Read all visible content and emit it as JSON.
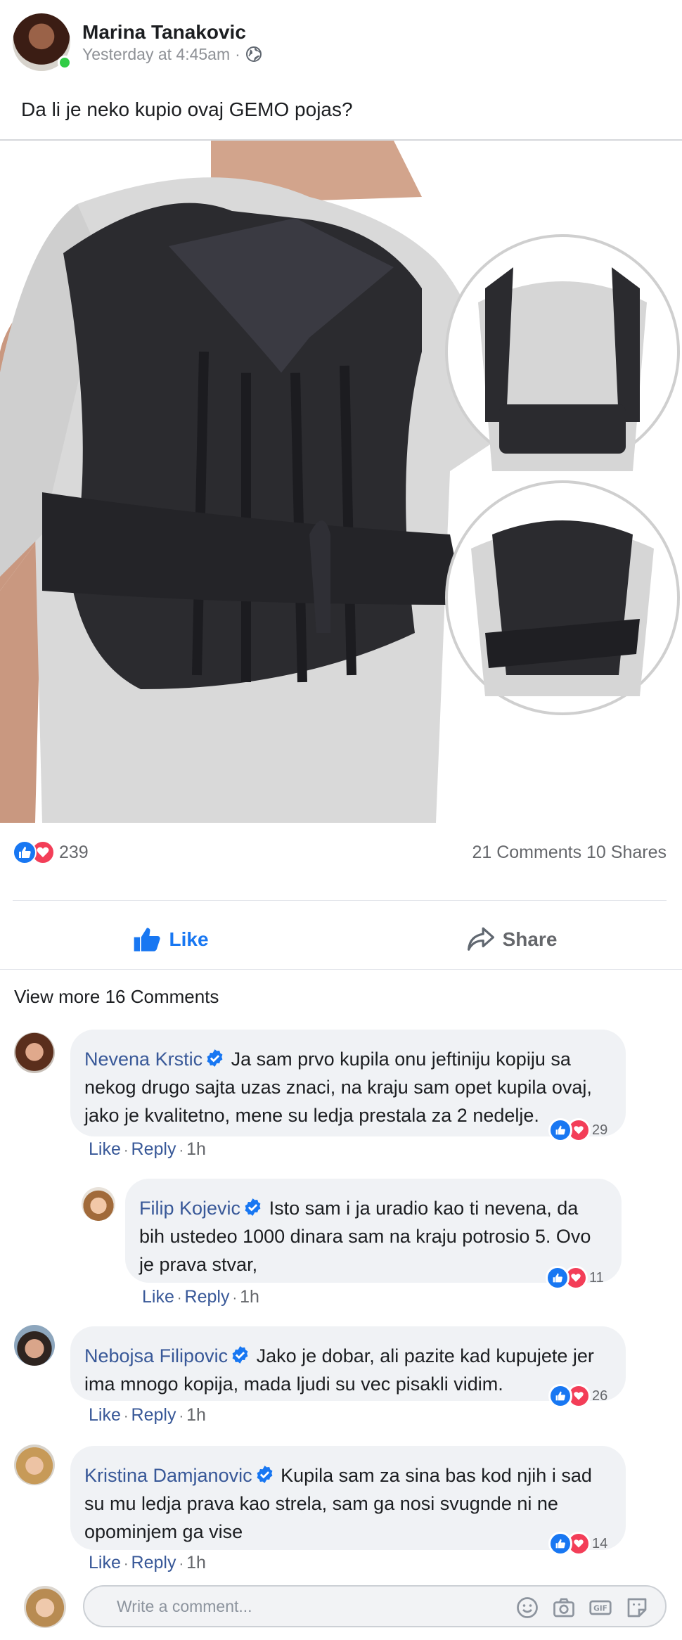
{
  "post": {
    "author": "Marina Tanakovic",
    "timestamp": "Yesterday at 4:45am",
    "meta_separator": "·",
    "privacy_icon": "globe-icon",
    "text": "Da li je neko kupio ovaj GEMO pojas?"
  },
  "stats": {
    "reaction_count": "239",
    "comments_shares": "21 Comments 10 Shares"
  },
  "actions": {
    "like_label": "Like",
    "share_label": "Share"
  },
  "view_more": "View more 16 Comments",
  "comments": [
    {
      "name": "Nevena Krstic",
      "text": "Ja sam prvo kupila onu jeftiniju kopiju sa nekog drugo sajta uzas znaci, na kraju sam opet kupila ovaj, jako je kvalitetno, mene su ledja prestala za 2 nedelje.",
      "reaction_count": "29",
      "like": "Like",
      "reply": "Reply",
      "time": "1h"
    },
    {
      "name": "Filip Kojevic",
      "text": "Isto sam i ja uradio kao ti nevena, da bih ustedeo 1000 dinara sam na kraju potrosio 5. Ovo je prava stvar,",
      "reaction_count": "11",
      "like": "Like",
      "reply": "Reply",
      "time": "1h"
    },
    {
      "name": "Nebojsa Filipovic",
      "text": "Jako je dobar, ali pazite kad kupujete jer ima mnogo kopija, mada ljudi su vec pisakli vidim.",
      "reaction_count": "26",
      "like": "Like",
      "reply": "Reply",
      "time": "1h"
    },
    {
      "name": "Kristina Damjanovic",
      "text": "Kupila sam za sina bas kod njih i sad su mu ledja prava kao strela, sam ga nosi svugnde ni ne opominjem ga vise",
      "reaction_count": "14",
      "like": "Like",
      "reply": "Reply",
      "time": "1h"
    }
  ],
  "write_comment": {
    "placeholder": "Write a comment..."
  },
  "colors": {
    "facebook_blue": "#1877f2",
    "name_blue": "#385898",
    "love_red": "#f33e58",
    "online_green": "#31cc46",
    "bubble_gray": "#f0f2f5"
  }
}
